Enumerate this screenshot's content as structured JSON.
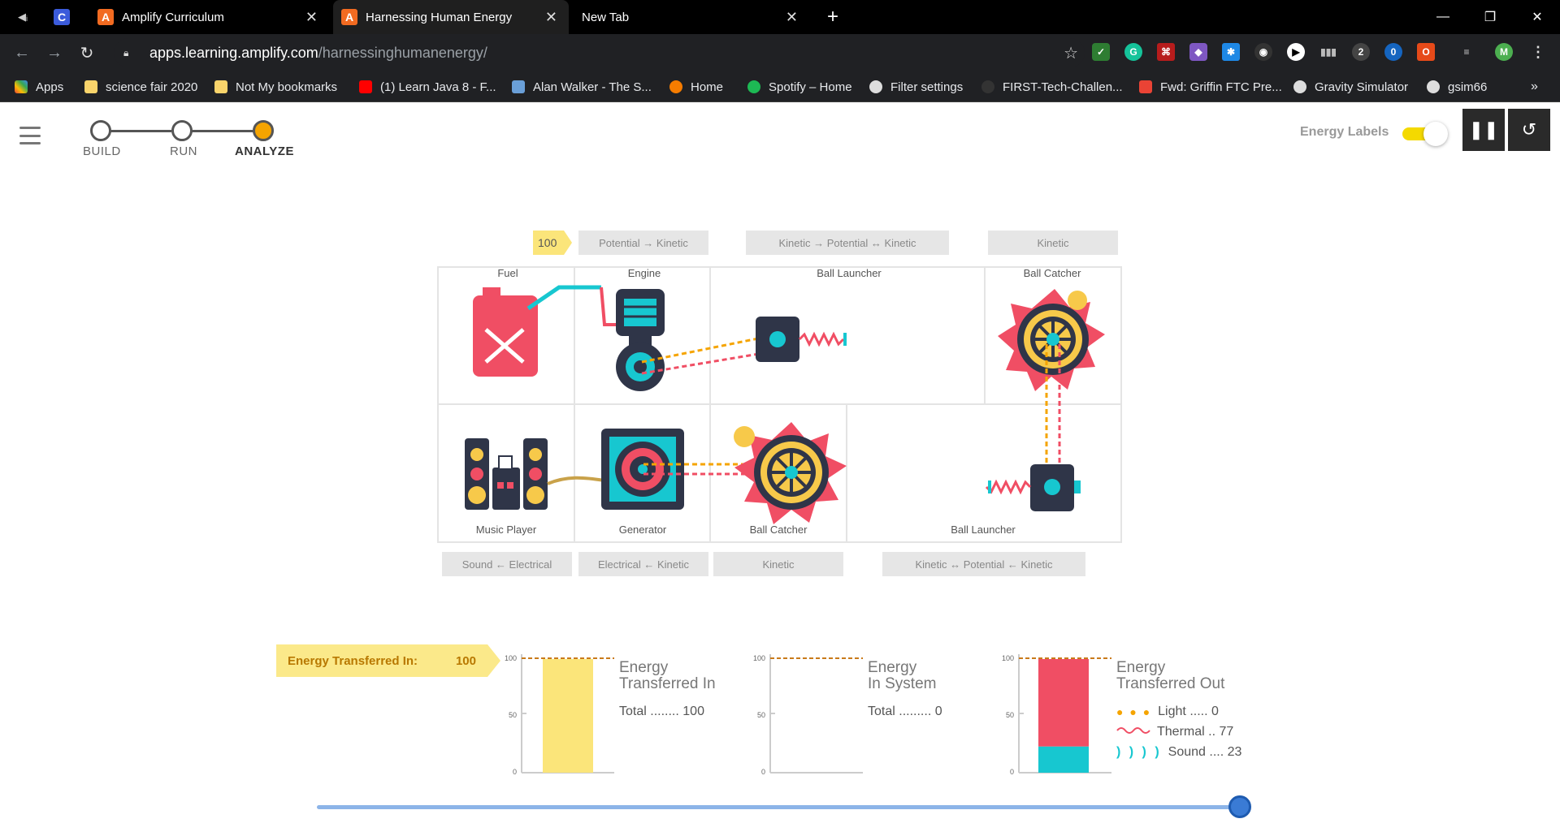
{
  "browser": {
    "tabs": [
      {
        "label": ""
      },
      {
        "label": ""
      },
      {
        "label": "Amplify Curriculum"
      },
      {
        "label": "Harnessing Human Energy"
      },
      {
        "label": "New Tab"
      }
    ],
    "url_host": "apps.learning.amplify.com",
    "url_path": "/harnessinghumanenergy/",
    "bookmarks": [
      {
        "label": "Apps"
      },
      {
        "label": "science fair 2020"
      },
      {
        "label": "Not My bookmarks"
      },
      {
        "label": "(1) Learn Java 8 - F..."
      },
      {
        "label": "Alan Walker - The S..."
      },
      {
        "label": "Home"
      },
      {
        "label": "Spotify – Home"
      },
      {
        "label": "Filter settings"
      },
      {
        "label": "FIRST-Tech-Challen..."
      },
      {
        "label": "Fwd: Griffin FTC Pre..."
      },
      {
        "label": "Gravity Simulator"
      },
      {
        "label": "gsim66"
      }
    ],
    "profile_initial": "M"
  },
  "app": {
    "steps": [
      "BUILD",
      "RUN",
      "ANALYZE"
    ],
    "energy_labels": "Energy Labels",
    "top_labels": {
      "badge": "100",
      "engine": "Potential → Kinetic",
      "launcher": "Kinetic → Potential ↔ Kinetic",
      "catcher": "Kinetic"
    },
    "section_labels": {
      "fuel": "Fuel",
      "engine": "Engine",
      "ball_launcher_top": "Ball Launcher",
      "ball_catcher_top": "Ball Catcher",
      "music_player": "Music Player",
      "generator": "Generator",
      "ball_catcher_bottom": "Ball Catcher",
      "ball_launcher_bottom": "Ball Launcher"
    },
    "bottom_labels": {
      "music": "Sound ← Electrical",
      "generator": "Electrical ← Kinetic",
      "catcher": "Kinetic",
      "launcher": "Kinetic ↔ Potential ← Kinetic"
    },
    "energy_in_label": "Energy Transferred In:",
    "energy_in_value": "100",
    "charts": [
      {
        "title_line1": "Energy",
        "title_line2": "Transferred In",
        "total_label": "Total",
        "total_dots": "........",
        "total_value": "100",
        "fill_fraction": 1.0,
        "ticks": [
          "100",
          "50",
          "0"
        ]
      },
      {
        "title_line1": "Energy",
        "title_line2": "In System",
        "total_label": "Total",
        "total_dots": ".........",
        "total_value": "0",
        "fill_fraction": 0.0,
        "ticks": [
          "100",
          "50",
          "0"
        ]
      },
      {
        "title_line1": "Energy",
        "title_line2": "Transferred Out",
        "ticks": [
          "100",
          "50",
          "0"
        ],
        "legend": [
          {
            "label": "Light",
            "dots": ".....",
            "value": "0",
            "color": "#f5a400"
          },
          {
            "label": "Thermal",
            "dots": "..",
            "value": "77",
            "color": "#f04e64"
          },
          {
            "label": "Sound",
            "dots": "....",
            "value": "23",
            "color": "#17c7d0"
          }
        ]
      }
    ],
    "colors": {
      "yellow": "#fbe57a",
      "thermal": "#f04e64",
      "sound": "#17c7d0",
      "accent": "#f5a400"
    }
  }
}
